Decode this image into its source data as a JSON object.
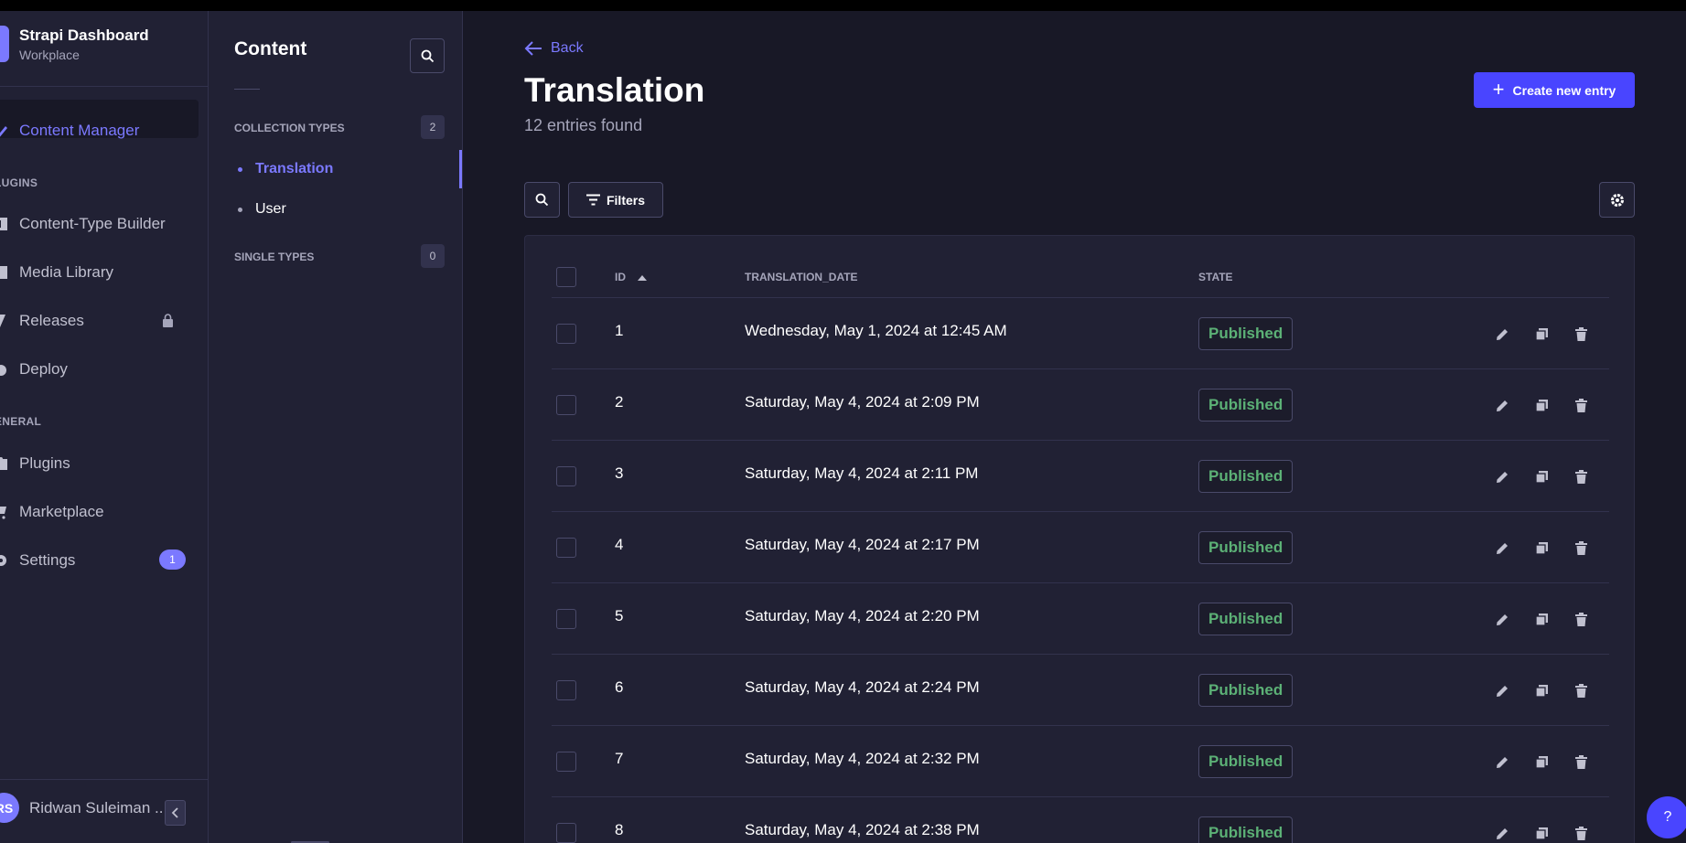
{
  "brand": {
    "title": "Strapi Dashboard",
    "subtitle": "Workplace"
  },
  "nav": {
    "content_manager": "Content Manager",
    "plugins_section": "LUGINS",
    "content_type_builder": "Content-Type Builder",
    "media_library": "Media Library",
    "releases": "Releases",
    "deploy": "Deploy",
    "general_section": "ENERAL",
    "plugins": "Plugins",
    "marketplace": "Marketplace",
    "settings": "Settings",
    "settings_badge": "1"
  },
  "user": {
    "initials": "RS",
    "name": "Ridwan Suleiman ..."
  },
  "subnav": {
    "title": "Content",
    "collection_types": "COLLECTION TYPES",
    "collection_count": "2",
    "items": [
      "Translation",
      "User"
    ],
    "single_types": "SINGLE TYPES",
    "single_count": "0"
  },
  "main": {
    "back": "Back",
    "title": "Translation",
    "subtitle": "12 entries found",
    "create": "Create new entry",
    "filters": "Filters"
  },
  "table": {
    "headers": {
      "id": "ID",
      "date": "TRANSLATION_DATE",
      "state": "STATE"
    },
    "rows": [
      {
        "id": "1",
        "date": "Wednesday, May 1, 2024 at 12:45 AM",
        "state": "Published"
      },
      {
        "id": "2",
        "date": "Saturday, May 4, 2024 at 2:09 PM",
        "state": "Published"
      },
      {
        "id": "3",
        "date": "Saturday, May 4, 2024 at 2:11 PM",
        "state": "Published"
      },
      {
        "id": "4",
        "date": "Saturday, May 4, 2024 at 2:17 PM",
        "state": "Published"
      },
      {
        "id": "5",
        "date": "Saturday, May 4, 2024 at 2:20 PM",
        "state": "Published"
      },
      {
        "id": "6",
        "date": "Saturday, May 4, 2024 at 2:24 PM",
        "state": "Published"
      },
      {
        "id": "7",
        "date": "Saturday, May 4, 2024 at 2:32 PM",
        "state": "Published"
      },
      {
        "id": "8",
        "date": "Saturday, May 4, 2024 at 2:38 PM",
        "state": "Published"
      }
    ]
  },
  "help": "?",
  "colors": {
    "accent": "#7b79ff",
    "primary": "#4945ff",
    "success": "#5cb176",
    "background": "#181826",
    "surface": "#212134"
  },
  "icons": [
    "back-arrow-icon",
    "search-icon",
    "filter-icon",
    "gear-icon",
    "pencil-icon",
    "duplicate-icon",
    "trash-icon",
    "lock-icon",
    "chevron-left-icon",
    "sort-up-icon",
    "plus-icon"
  ]
}
